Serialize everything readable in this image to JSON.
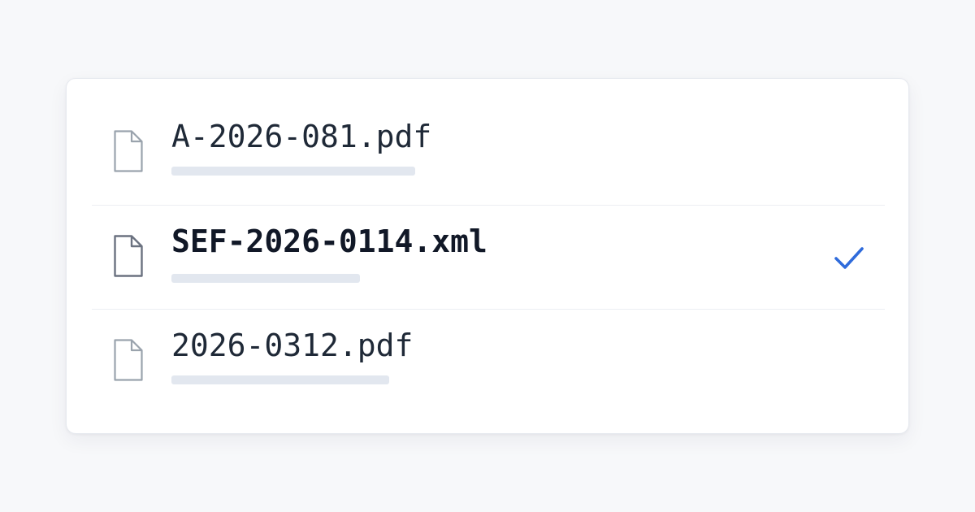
{
  "files": [
    {
      "name": "A-2026-081.pdf",
      "icon": "file-icon",
      "selected": false
    },
    {
      "name": "SEF-2026-0114.xml",
      "icon": "file-icon",
      "selected": true
    },
    {
      "name": "2026-0312.pdf",
      "icon": "file-icon",
      "selected": false
    }
  ],
  "selection_icon": "checkmark-icon",
  "colors": {
    "background": "#f7f8fa",
    "card": "#ffffff",
    "text": "#1f2937",
    "placeholder_bar": "#e2e7ef",
    "accent_check": "#2f6bdb",
    "icon_default": "#9aa3ad",
    "icon_selected": "#6b7280"
  }
}
